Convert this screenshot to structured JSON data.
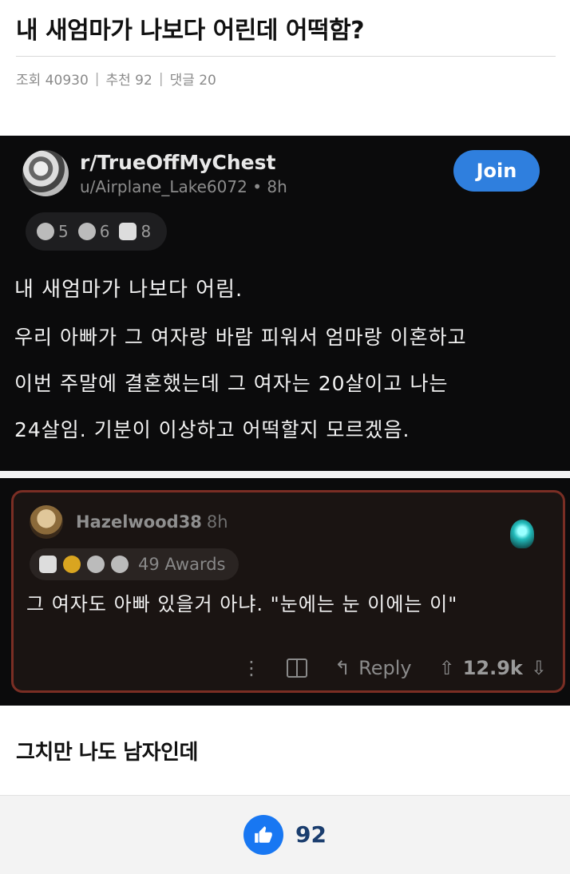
{
  "post": {
    "title": "내 새엄마가 나보다 어린데 어떡함?",
    "views_label": "조회 40930",
    "recommend_label": "추천 92",
    "comments_label": "댓글 20",
    "body": "그치만 나도 남자인데"
  },
  "screenshot": {
    "subreddit": "r/TrueOffMyChest",
    "user_time": "u/Airplane_Lake6072 • 8h",
    "join_label": "Join",
    "awards": [
      "5",
      "6",
      "8"
    ],
    "body_lines": [
      "내 새엄마가 나보다 어림.",
      "우리 아빠가 그 여자랑 바람 피워서 엄마랑 이혼하고",
      "이번 주말에 결혼했는데 그 여자는 20살이고 나는",
      "24살임. 기분이 이상하고 어떡할지 모르겠음."
    ],
    "comment": {
      "user": "Hazelwood38",
      "time": "8h",
      "awards_label": "49 Awards",
      "text": "그 여자도 아빠 있을거 아냐. \"눈에는 눈 이에는 이\"",
      "reply_label": "Reply",
      "vote_count": "12.9k"
    }
  },
  "likes": {
    "count": "92"
  },
  "colors": {
    "join_blue": "#2f7fde",
    "like_blue": "#1877f2",
    "comment_border": "#7a2e24"
  }
}
